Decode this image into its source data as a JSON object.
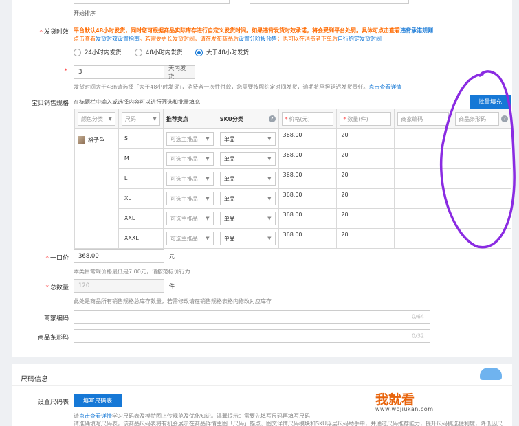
{
  "top": {
    "sort_start": "开始排序"
  },
  "ship": {
    "label": "发货时效",
    "warn": "平台默认48小时发货，同时您可根据商品实际库存进行自定义发货时间。如果违背发货时效承诺，将会受到平台处罚。具体可点击查看",
    "warn_link": "违背承诺规则",
    "line2_a": "点击查看",
    "line2_link1": "发货时效设置指南",
    "line2_b": "。若需要更长发货时间，请在发布商品后",
    "line2_link2": "设置分阶段预售",
    "line2_c": "；也可以在消费者下单后",
    "line2_link3": "自行约定发货时间",
    "options": [
      "24小时内发货",
      "48小时内发货",
      "大于48小时发货"
    ],
    "days_value": "3",
    "days_suffix": "天内发货",
    "note": "发货时间大于48h请选择「大于48小时发货」，消费者一次性付款，您需要按照约定时间发货，逾期将承担延迟发货责任。",
    "note_link": "点击查看详情"
  },
  "sku": {
    "label": "宝贝销售规格",
    "hint": "在标题栏中输入或选择内容可以进行筛选和批量填充",
    "batch_btn": "批量填充",
    "headers": {
      "color": "颜色分类",
      "size": "尺码",
      "selling_point": "推荐卖点",
      "sku_type": "SKU分类",
      "price": "价格(元)",
      "qty": "数量(件)",
      "merchant_code": "商家编码",
      "barcode": "商品条形码"
    },
    "color_name": "格子色",
    "select_placeholder": "可选主推品",
    "rows": [
      {
        "size": "S",
        "type": "单品",
        "price": "368.00",
        "qty": "20"
      },
      {
        "size": "M",
        "type": "单品",
        "price": "368.00",
        "qty": "20"
      },
      {
        "size": "L",
        "type": "单品",
        "price": "368.00",
        "qty": "20"
      },
      {
        "size": "XL",
        "type": "单品",
        "price": "368.00",
        "qty": "20"
      },
      {
        "size": "XXL",
        "type": "单品",
        "price": "368.00",
        "qty": "20"
      },
      {
        "size": "XXXL",
        "type": "单品",
        "price": "368.00",
        "qty": "20"
      }
    ]
  },
  "price": {
    "label": "一口价",
    "value": "368.00",
    "unit": "元",
    "note": "本类目常规价格最低是7.00元，请按范标价行为"
  },
  "total": {
    "label": "总数量",
    "value": "120",
    "unit": "件",
    "note": "此处是商品所有销售规格总库存数量，若需修改请在销售规格表格内修改对应库存"
  },
  "merchant": {
    "label": "商家编码",
    "counter": "0/64"
  },
  "barcode": {
    "label": "商品条形码",
    "counter": "0/32"
  },
  "size_section": {
    "title": "尺码信息",
    "label": "设置尺码表",
    "btn": "填写尺码表",
    "note1_a": "请",
    "note1_link": "点击查看详情",
    "note1_b": "学习尺码表及模特图上传规范及优化知识。温馨提示：需要先填写尺码再填写尺码",
    "note2": "请准确填写尺码表，该商品尺码表将有机会展示在商品详情主图「尺码」锚点、图文详情尺码模块和SKU浮层尺码助手中，并通过尺码推荐能力，提升尺码挑选便利度，降低因尺"
  },
  "watermark": {
    "brand": "我就看",
    "url": "www.wojiukan.com"
  },
  "colors": {
    "accent": "#1678d6",
    "warn": "#ff6a00",
    "annotation": "#8a2be2"
  }
}
